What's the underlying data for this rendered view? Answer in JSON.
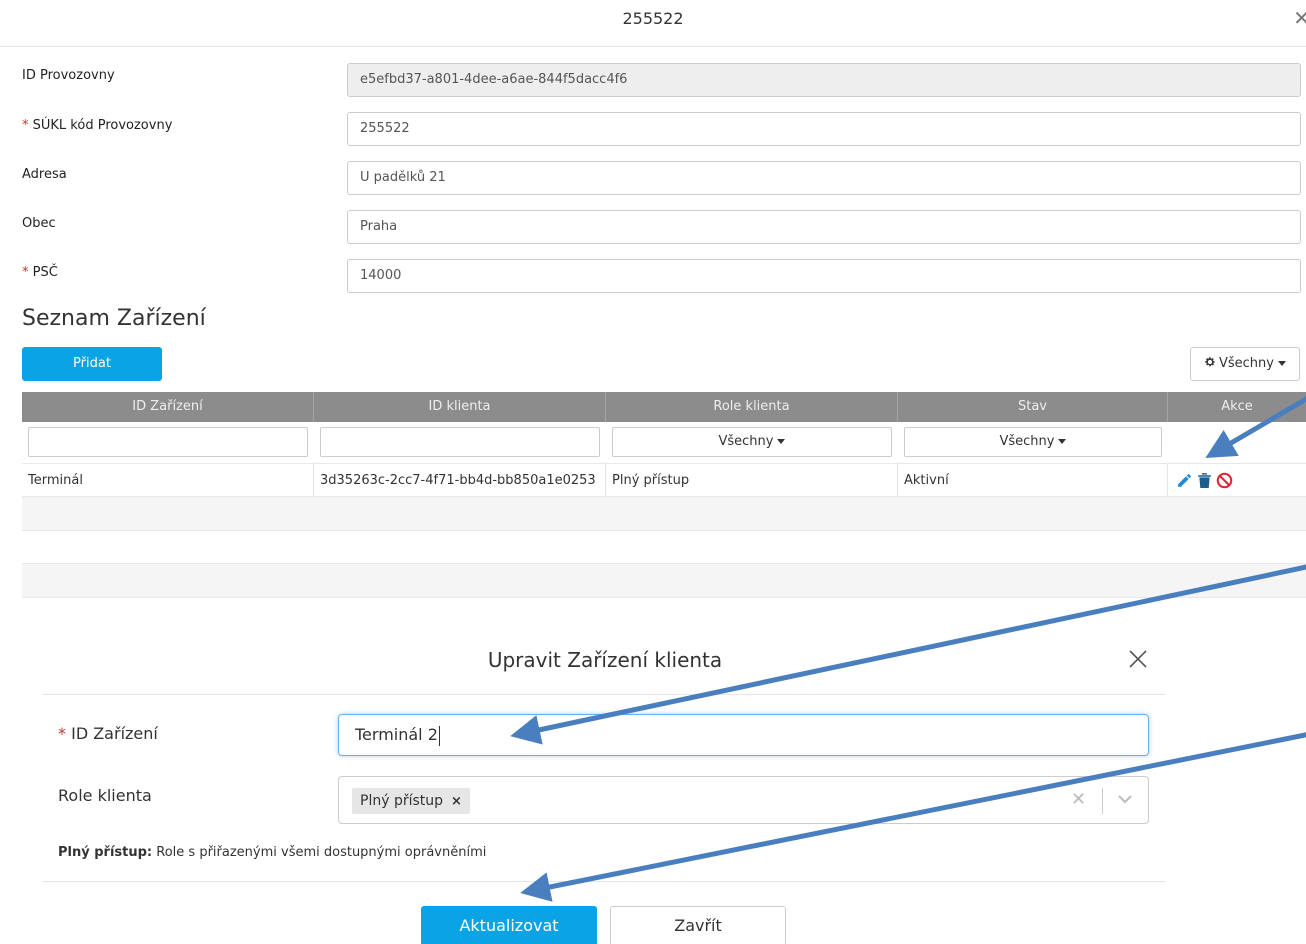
{
  "top_modal": {
    "title": "255522",
    "close_glyph": "✕",
    "fields": [
      {
        "label": "ID Provozovny",
        "required": false,
        "value": "e5efbd37-a801-4dee-a6ae-844f5dacc4f6",
        "readonly": true
      },
      {
        "label": "SÚKL kód Provozovny",
        "required": true,
        "value": "255522",
        "readonly": false
      },
      {
        "label": "Adresa",
        "required": false,
        "value": "U padělků 21",
        "readonly": false
      },
      {
        "label": "Obec",
        "required": false,
        "value": "Praha",
        "readonly": false
      },
      {
        "label": "PSČ",
        "required": true,
        "value": "14000",
        "readonly": false
      }
    ],
    "required_marker": "*"
  },
  "devices": {
    "section_title": "Seznam Zařízení",
    "add_button": "Přidat",
    "filter_button": "Všechny",
    "columns": [
      "ID Zařízení",
      "ID klienta",
      "Role klienta",
      "Stav",
      "Akce"
    ],
    "filters": {
      "role": "Všechny",
      "status": "Všechny"
    },
    "rows": [
      {
        "device_id": "Terminál",
        "client_id": "3d35263c-2cc7-4f71-bb4d-bb850a1e0253",
        "role": "Plný přístup",
        "status": "Aktivní"
      }
    ],
    "action_icons": [
      "pencil-icon",
      "trash-icon",
      "ban-icon"
    ]
  },
  "edit_dialog": {
    "title": "Upravit Zařízení klienta",
    "device_label": "ID Zařízení",
    "device_value": "Terminál 2",
    "role_label": "Role klienta",
    "role_tag": "Plný přístup",
    "tag_remove": "×",
    "clear_glyph": "✕",
    "description_term": "Plný přístup:",
    "description_text": "Role s přiřazenými všemi dostupnými oprávněními",
    "update_button": "Aktualizovat",
    "close_button": "Zavřít"
  },
  "colors": {
    "primary": "#0aa3e6",
    "header_gray": "#8c8c8c",
    "required_red": "#c0392b",
    "annotation_arrow": "#4a7fbf",
    "icon_blue": "#1a8cd8",
    "icon_red": "#e0263a",
    "icon_dark": "#1f5e8c"
  }
}
